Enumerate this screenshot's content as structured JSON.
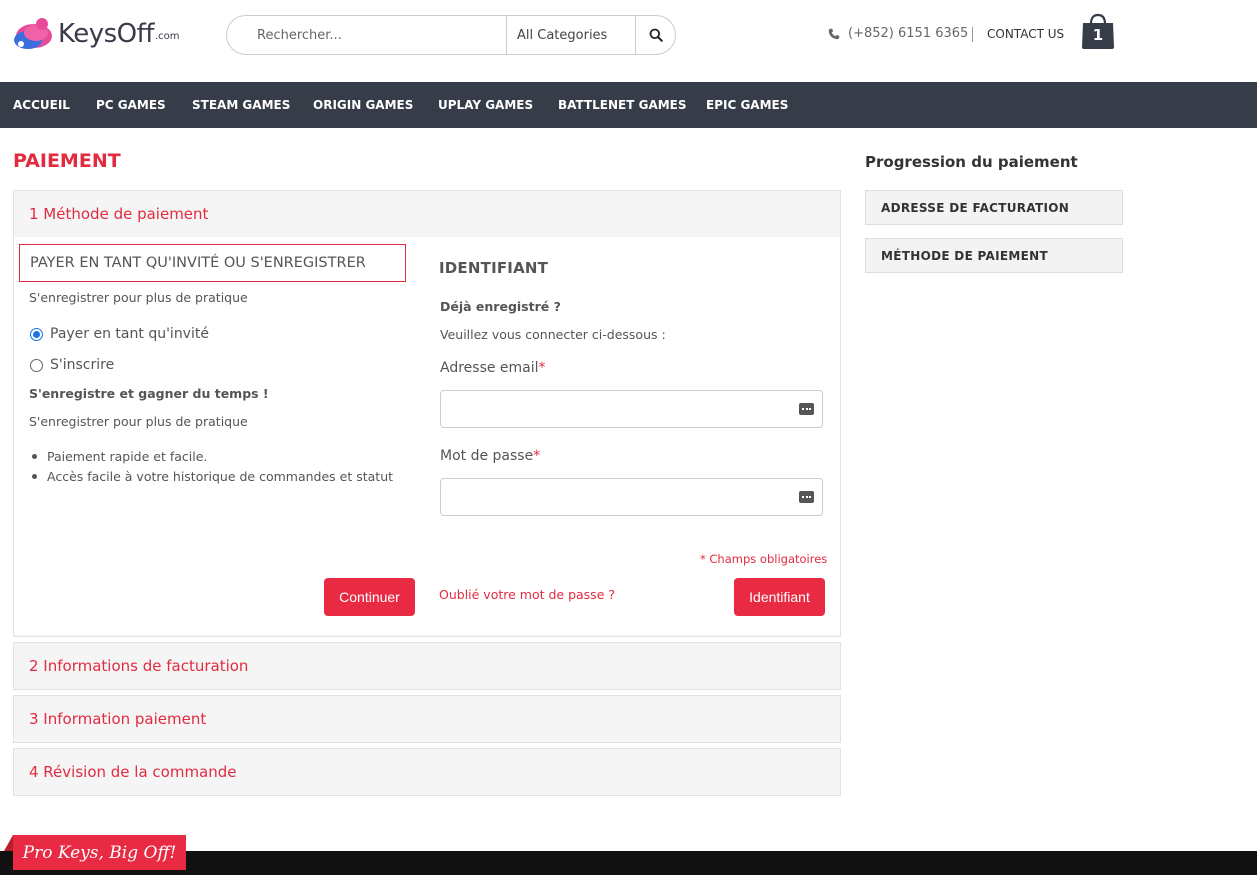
{
  "brand": {
    "name": "KeysOff",
    "suffix": ".com",
    "accent": "#e22b40",
    "nav_bg": "#363c48"
  },
  "header": {
    "search_placeholder": "Rechercher...",
    "category": "All Categories",
    "phone": "(+852) 6151 6365",
    "contact": "CONTACT US",
    "cart_count": "1"
  },
  "nav": [
    "ACCUEIL",
    "PC GAMES",
    "STEAM GAMES",
    "ORIGIN GAMES",
    "UPLAY GAMES",
    "BATTLENET GAMES",
    "EPIC GAMES"
  ],
  "page_title": "PAIEMENT",
  "sidebar": {
    "title": "Progression du paiement",
    "items": [
      "ADRESSE DE FACTURATION",
      "MÉTHODE DE PAIEMENT"
    ]
  },
  "sections": [
    "1 Méthode de paiement",
    "2 Informations de facturation",
    "3 Information paiement",
    "4 Révision de la commande"
  ],
  "guest": {
    "title": "PAYER EN TANT QU'INVITÉ OU S'ENREGISTRER",
    "subtitle": "S'enregistrer pour plus de pratique",
    "option_guest": "Payer en tant qu'invité",
    "option_register": "S'inscrire",
    "benefit_title": "S'enregistre et gagner du temps !",
    "benefit_sub": "S'enregistrer pour plus de pratique",
    "bullets": [
      "Paiement rapide et facile.",
      "Accès facile à votre historique de commandes et statut"
    ],
    "continue": "Continuer"
  },
  "login": {
    "title": "IDENTIFIANT",
    "already": "Déjà enregistré ?",
    "instruction": "Veuillez vous connecter ci-dessous :",
    "email_label": "Adresse email",
    "password_label": "Mot de passe",
    "required_mark": "*",
    "required_note": "* Champs obligatoires",
    "forgot": "Oublié votre mot de passe ?",
    "submit": "Identifiant"
  },
  "footer": {
    "tagline": "Pro Keys, Big Off!"
  }
}
